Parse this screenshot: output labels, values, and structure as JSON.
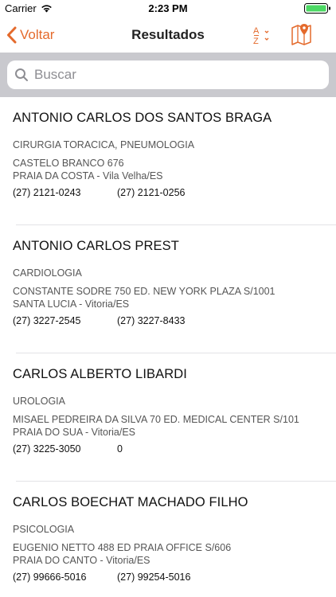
{
  "status_bar": {
    "carrier": "Carrier",
    "time": "2:23 PM"
  },
  "nav": {
    "back_label": "Voltar",
    "title": "Resultados",
    "sort_icon": "sort-az-icon",
    "map_icon": "map-pin-icon",
    "accent_color": "#e46a2c"
  },
  "search": {
    "placeholder": "Buscar",
    "value": ""
  },
  "results": [
    {
      "name": "ANTONIO CARLOS DOS SANTOS BRAGA",
      "specialty": "CIRURGIA TORACICA, PNEUMOLOGIA",
      "address_line1": "CASTELO BRANCO 676",
      "address_line2": "PRAIA DA COSTA - Vila Velha/ES",
      "phone1": "(27) 2121-0243",
      "phone2": "(27) 2121-0256"
    },
    {
      "name": "ANTONIO CARLOS PREST",
      "specialty": "CARDIOLOGIA",
      "address_line1": "CONSTANTE SODRE 750 ED. NEW YORK PLAZA S/1001",
      "address_line2": "SANTA LUCIA - Vitoria/ES",
      "phone1": "(27) 3227-2545",
      "phone2": "(27) 3227-8433"
    },
    {
      "name": "CARLOS ALBERTO LIBARDI",
      "specialty": "UROLOGIA",
      "address_line1": "MISAEL PEDREIRA DA SILVA 70 ED. MEDICAL CENTER S/101",
      "address_line2": "PRAIA DO SUA - Vitoria/ES",
      "phone1": "(27) 3225-3050",
      "phone2": "0"
    },
    {
      "name": "CARLOS BOECHAT MACHADO FILHO",
      "specialty": "PSICOLOGIA",
      "address_line1": "EUGENIO NETTO 488 ED PRAIA OFFICE S/606",
      "address_line2": "PRAIA DO CANTO - Vitoria/ES",
      "phone1": "(27) 99666-5016",
      "phone2": "(27) 99254-5016"
    }
  ]
}
